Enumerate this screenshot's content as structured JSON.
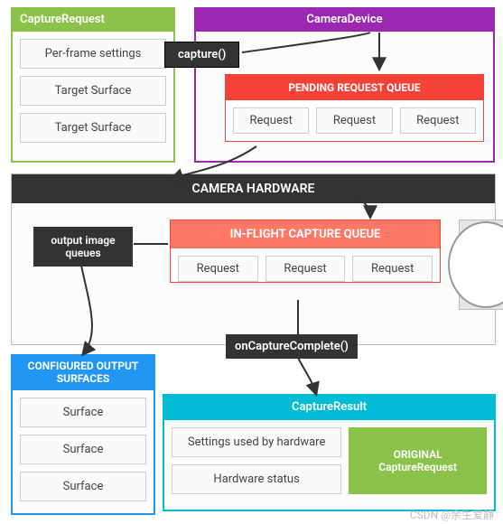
{
  "captureRequest": {
    "title": "CaptureRequest",
    "perFrame": "Per-frame settings",
    "targetSurface1": "Target Surface",
    "targetSurface2": "Target Surface"
  },
  "cameraDevice": {
    "title": "CameraDevice",
    "captureMethod": "capture()",
    "pendingQueue": {
      "title": "PENDING REQUEST QUEUE",
      "req1": "Request",
      "req2": "Request",
      "req3": "Request"
    }
  },
  "hardware": {
    "title": "CAMERA HARDWARE",
    "outputQueues": "output image\nqueues",
    "inFlight": {
      "title": "IN-FLIGHT CAPTURE QUEUE",
      "req1": "Request",
      "req2": "Request",
      "req3": "Request"
    }
  },
  "onCaptureComplete": "onCaptureComplete()",
  "configuredOutputSurfaces": {
    "title": "CONFIGURED OUTPUT\nSURFACES",
    "s1": "Surface",
    "s2": "Surface",
    "s3": "Surface"
  },
  "captureResult": {
    "title": "CaptureResult",
    "settings": "Settings used by hardware",
    "status": "Hardware status",
    "original": "ORIGINAL\nCaptureRequest"
  },
  "watermark": "CSDN @余生爱静"
}
